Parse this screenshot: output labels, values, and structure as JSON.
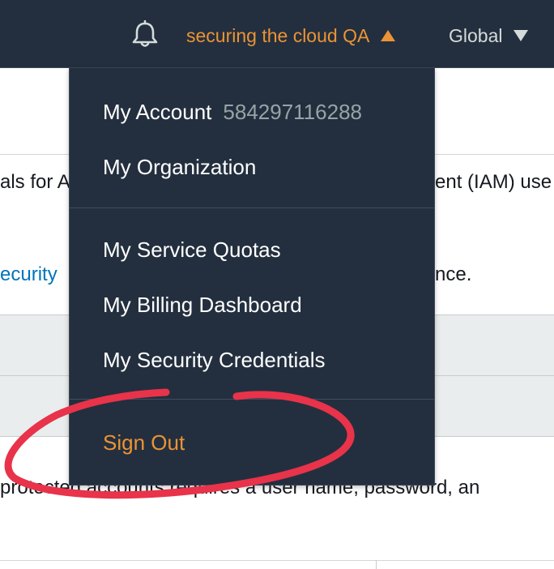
{
  "header": {
    "account_name": "securing the cloud QA",
    "region": "Global",
    "icons": {
      "notifications": "bell-icon",
      "account_caret": "caret-up-icon",
      "region_caret": "caret-down-icon"
    }
  },
  "background": {
    "line1_left": "als for A",
    "line1_right": "ent (IAM) use",
    "link_fragment": "ecurity",
    "line2_right": "nce.",
    "line3": "protected accounts requires a user name, password, an"
  },
  "menu": {
    "account_label": "My Account",
    "account_id": "584297116288",
    "organization": "My Organization",
    "service_quotas": "My Service Quotas",
    "billing_dashboard": "My Billing Dashboard",
    "security_credentials": "My Security Credentials",
    "sign_out": "Sign Out"
  },
  "colors": {
    "nav_background": "#232f3e",
    "accent_orange": "#ec9335",
    "annotation_red": "#e8334a",
    "link_blue": "#0073bb"
  }
}
